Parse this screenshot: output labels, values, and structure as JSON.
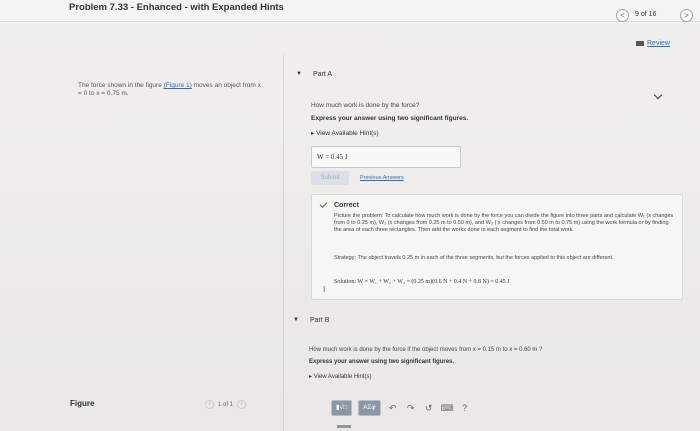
{
  "header": {
    "title": "Problem 7.33 - Enhanced - with Expanded Hints",
    "count": "9 of 16",
    "prev_icon": "<",
    "next_icon": ">",
    "review_label": "Review"
  },
  "left": {
    "problem_text_pre": "The force shown in the figure ",
    "figure_link": "(Figure 1)",
    "problem_text_post": " moves an object from x = 0 to x = 0.75 m.",
    "figure_label": "Figure",
    "figure_pager": "1 of 1"
  },
  "partA": {
    "label": "Part A",
    "question": "How much work is done by the force?",
    "instruction": "Express your answer using two significant figures.",
    "hints_label": "View Available Hint(s)",
    "answer": "W =  0.45  J",
    "submit_label": "Submit",
    "previous_answers": "Previous Answers",
    "correct_title": "Correct",
    "feedback": "Picture the problem: To calculate how much work is done by the force you can divide the figure into three parts and calculate W₁ (x changes from 0 to 0.25 m), W₂ (x changes from 0.25 m to 0.50 m), and W₃ ( x changes from 0.50 m to 0.75 m) using the work formula or by finding the area of each three rectangles. Then add the works done in each segment to find the total work.",
    "strategy": "Strategy: The object travels 0.25 m in each of the three segments, but the forces applied to this object are different.",
    "solution": "Solution: W = W₁ + W₂ + W₃ = (0.25 m)(0.6 N + 0.4 N + 0.8 N) = 0.45 J"
  },
  "partB": {
    "label": "Part B",
    "question": "How much work is done by the force if the object moves from x = 0.15 m to x = 0.60 m ?",
    "instruction": "Express your answer using two significant figures.",
    "hints_label": "View Available Hint(s)",
    "tools": {
      "template": "▮√□",
      "symbols": "AΣφ",
      "undo": "↶",
      "redo": "↷",
      "reset": "↺",
      "keyboard": "⌨",
      "help": "?"
    }
  }
}
